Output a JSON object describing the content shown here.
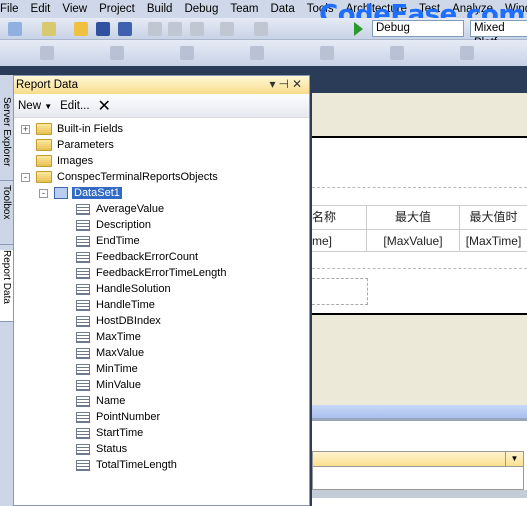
{
  "menu": [
    "File",
    "Edit",
    "View",
    "Project",
    "Build",
    "Debug",
    "Team",
    "Data",
    "Tools",
    "Architecture",
    "Test",
    "Analyze",
    "Wind"
  ],
  "watermark": "CodeEase.com",
  "toolbar": {
    "config": "Debug",
    "platform": "Mixed Platf"
  },
  "side_tabs": [
    "Server Explorer",
    "Toolbox",
    "Report Data"
  ],
  "panel": {
    "title": "Report Data",
    "new_label": "New",
    "edit_label": "Edit...",
    "delete_icon": "close-icon"
  },
  "tree": {
    "folders": [
      "Built-in Fields",
      "Parameters",
      "Images",
      "ConspecTerminalReportsObjects"
    ],
    "dataset": "DataSet1",
    "fields": [
      "AverageValue",
      "Description",
      "EndTime",
      "FeedbackErrorCount",
      "FeedbackErrorTimeLength",
      "HandleSolution",
      "HandleTime",
      "HostDBIndex",
      "MaxTime",
      "MaxValue",
      "MinTime",
      "MinValue",
      "Name",
      "PointNumber",
      "StartTime",
      "Status",
      "TotalTimeLength"
    ]
  },
  "report_table": {
    "headers": [
      "名称",
      "最大值",
      "最大值时"
    ],
    "row": [
      "me]",
      "[MaxValue]",
      "[MaxTime]"
    ]
  }
}
